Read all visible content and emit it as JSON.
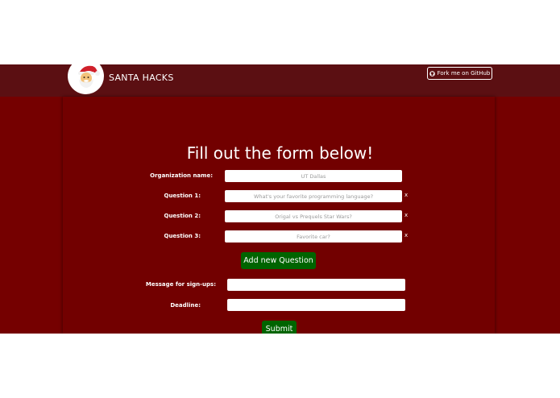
{
  "header": {
    "brand": "SANTA HACKS",
    "fork_label": "Fork me on GitHub"
  },
  "form": {
    "title": "Fill out the form below!",
    "org_label": "Organization name:",
    "org_placeholder": "UT Dallas",
    "questions": [
      {
        "label": "Question 1:",
        "placeholder": "What's your favorite programming language?",
        "remove": "x"
      },
      {
        "label": "Question 2:",
        "placeholder": "Origal vs Prequels Star Wars?",
        "remove": "x"
      },
      {
        "label": "Question 3:",
        "placeholder": "Favorite car?",
        "remove": "x"
      }
    ],
    "add_question_label": "Add new Question",
    "message_label": "Message for sign-ups:",
    "message_value": "",
    "deadline_label": "Deadline:",
    "deadline_value": "",
    "submit_label": "Submit"
  },
  "colors": {
    "background": "#750000",
    "navbar": "#5b0f12",
    "button_green": "#006400"
  },
  "icons": {
    "logo": "santa-icon",
    "fork": "github-icon"
  }
}
